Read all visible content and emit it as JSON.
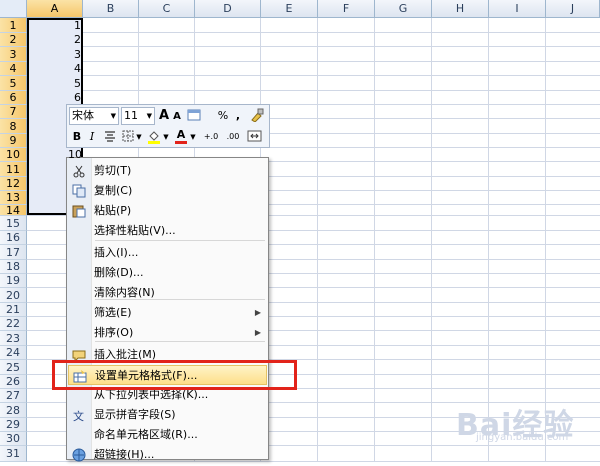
{
  "columns": [
    "A",
    "B",
    "C",
    "D",
    "E",
    "F",
    "G",
    "H",
    "I",
    "J"
  ],
  "rows": [
    "1",
    "2",
    "3",
    "4",
    "5",
    "6",
    "7",
    "8",
    "9",
    "10",
    "11",
    "12",
    "13",
    "14",
    "15",
    "16",
    "17",
    "18",
    "19",
    "20",
    "21",
    "22",
    "23",
    "24",
    "25",
    "26",
    "27",
    "28",
    "29",
    "30",
    "31"
  ],
  "cells_a": [
    "1",
    "2",
    "3",
    "4",
    "5",
    "6",
    "",
    "",
    "",
    "10"
  ],
  "mini_toolbar": {
    "font_name": "宋体",
    "font_size": "11",
    "grow_font": "A",
    "shrink_font": "A",
    "percent": "%",
    "comma": ",",
    "bold": "B",
    "italic": "I",
    "font_color": "A",
    "inc_decimal": "+.0",
    "dec_decimal": ".00",
    "font_color_hex": "#e2231a",
    "fill_color_hex": "#ffff00"
  },
  "context_menu": {
    "items": [
      {
        "label": "剪切(T)",
        "icon": "scissors-icon"
      },
      {
        "label": "复制(C)",
        "icon": "copy-icon"
      },
      {
        "label": "粘贴(P)",
        "icon": "paste-icon"
      },
      {
        "label": "选择性粘贴(V)...",
        "icon": ""
      },
      {
        "label": "插入(I)...",
        "icon": ""
      },
      {
        "label": "删除(D)...",
        "icon": ""
      },
      {
        "label": "清除内容(N)",
        "icon": ""
      },
      {
        "label": "筛选(E)",
        "icon": ""
      },
      {
        "label": "排序(O)",
        "icon": ""
      },
      {
        "label": "插入批注(M)",
        "icon": "comment-icon"
      },
      {
        "label": "设置单元格格式(F)...",
        "icon": "format-cells-icon"
      },
      {
        "label": "从下拉列表中选择(K)...",
        "icon": ""
      },
      {
        "label": "显示拼音字段(S)",
        "icon": "phonetic-icon"
      },
      {
        "label": "命名单元格区域(R)...",
        "icon": ""
      },
      {
        "label": "超链接(H)...",
        "icon": "hyperlink-icon"
      }
    ],
    "highlight_color": "#fddf8a",
    "annotation_color": "#e2231a"
  },
  "watermark": {
    "text": "Bai经验",
    "sub": "jingyan.baidu.com"
  }
}
